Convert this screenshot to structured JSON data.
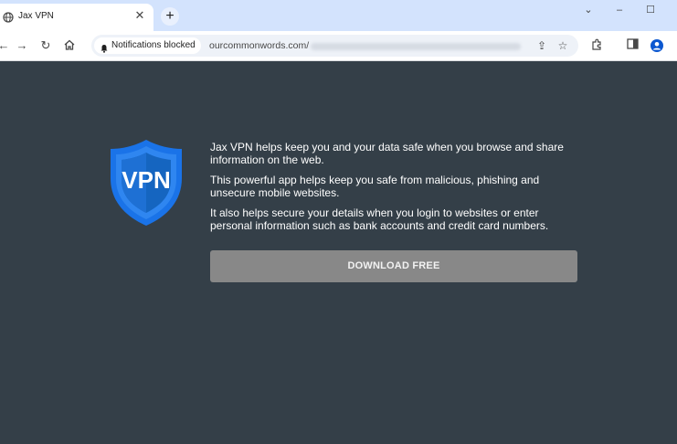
{
  "browser": {
    "tab": {
      "title": "Jax VPN",
      "favicon": "globe-icon",
      "close_icon": "close-icon"
    },
    "new_tab_icon": "plus-icon",
    "window_controls": [
      "chevron-down-icon",
      "minimize-icon",
      "maximize-icon"
    ],
    "nav": [
      "back-icon",
      "forward-icon",
      "reload-icon",
      "home-icon"
    ],
    "omnibox": {
      "chip_label": "Notifications blocked",
      "chip_icon": "bell-icon",
      "url": "ourcommonwords.com/"
    },
    "right_icons": [
      "share-icon",
      "star-icon",
      "extensions-icon",
      "side-panel-icon",
      "profile-icon"
    ]
  },
  "page": {
    "logo_text": "VPN",
    "paragraphs": [
      "Jax VPN helps keep you and your data safe when you browse and share information on the web.",
      "This powerful app helps keep you safe from malicious, phishing and unsecure mobile websites.",
      "It also helps secure your details when you login to websites or enter personal information such as bank accounts and credit card numbers."
    ],
    "download_button": "DOWNLOAD FREE"
  },
  "colors": {
    "page_bg": "#343f48",
    "button_bg": "#888888",
    "shield_blue": "#1a73e8"
  }
}
